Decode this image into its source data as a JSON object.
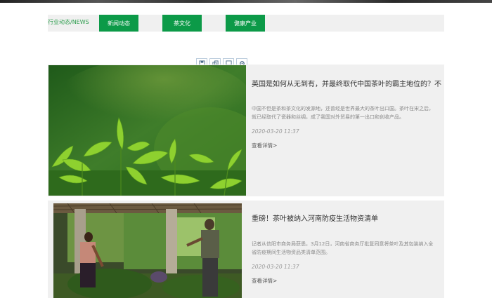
{
  "nav": {
    "label": "行业动态/NEWS",
    "tabs": [
      {
        "label": "新闻动态"
      },
      {
        "label": "茶文化"
      },
      {
        "label": "健康产业"
      }
    ]
  },
  "edit_toolbar": {
    "icons": [
      "save-icon",
      "copy-icon",
      "display-icon",
      "settings-icon"
    ]
  },
  "articles": [
    {
      "title": "英国是如何从无到有，并最终取代中国茶叶的霸主地位的？不",
      "desc": "中国不但是茶和茶文化的发源地，还曾经是世界最大的茶叶出口国。茶叶在宋之后，就已经取代了瓷器和丝绸，成了我国对外贸易的第一出口和创收产品。",
      "date": "2020-03-20 11:37",
      "more": "查看详情>"
    },
    {
      "title": "重磅！茶叶被纳入河南防疫生活物资清单",
      "desc": "记者从信阳市商务局获悉，3月12日，河南省商务厅批复同意将茶叶及其包装纳入全省防疫期间生活物资品类清单范围。",
      "date": "2020-03-20 11:37",
      "more": "查看详情>"
    }
  ],
  "colors": {
    "accent": "#0c9a48",
    "label": "#2f9e4f",
    "panel": "#f0f0f0"
  }
}
